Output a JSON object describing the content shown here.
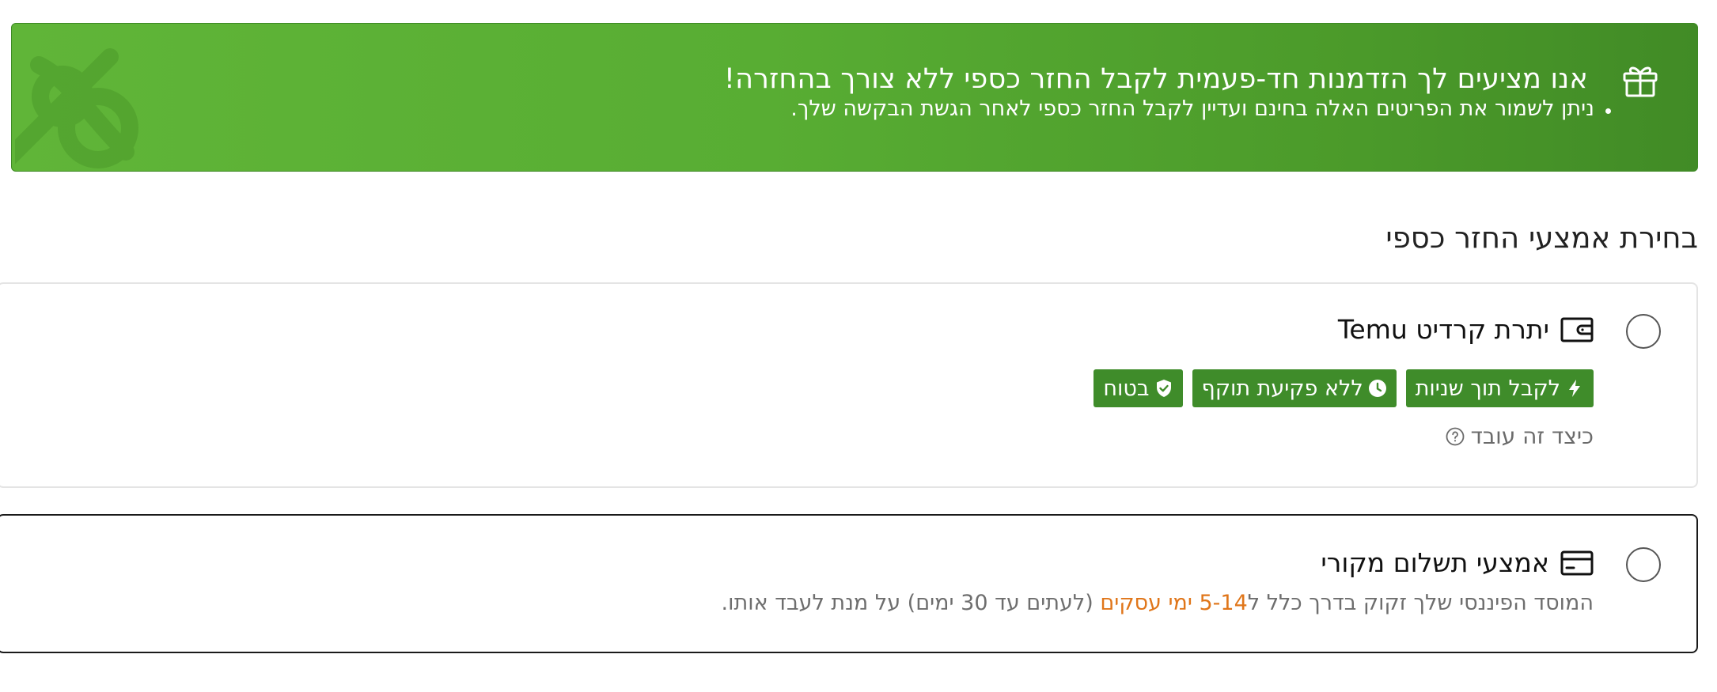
{
  "banner": {
    "title": "אנו מציעים לך הזדמנות חד-פעמית לקבל החזר כספי ללא צורך בהחזרה!",
    "subtitle": "ניתן לשמור את הפריטים האלה בחינם ועדיין לקבל החזר כספי לאחר הגשת הבקשה שלך.",
    "icon": "gift-icon",
    "color": "#5bb033"
  },
  "section": {
    "title": "בחירת אמצעי החזר כספי"
  },
  "options": {
    "credit": {
      "title": "יתרת קרדיט Temu",
      "icon": "wallet-icon",
      "badges": {
        "instant": "לקבל תוך שניות",
        "no_expiry": "ללא פקיעת תוקף",
        "safe": "בטוח"
      },
      "badge_color": "#3f8c2a",
      "how_link": "כיצד זה עובד",
      "selected": false
    },
    "original": {
      "title": "אמצעי תשלום מקורי",
      "icon": "credit-card-icon",
      "desc_before": "המוסד הפיננסי שלך זקוק בדרך כלל ל",
      "desc_highlight": "5-14 ימי עסקים",
      "desc_after": " (לעתים עד 30 ימים) על מנת לעבד אותו.",
      "highlight_color": "#e0761a",
      "selected": false
    }
  }
}
